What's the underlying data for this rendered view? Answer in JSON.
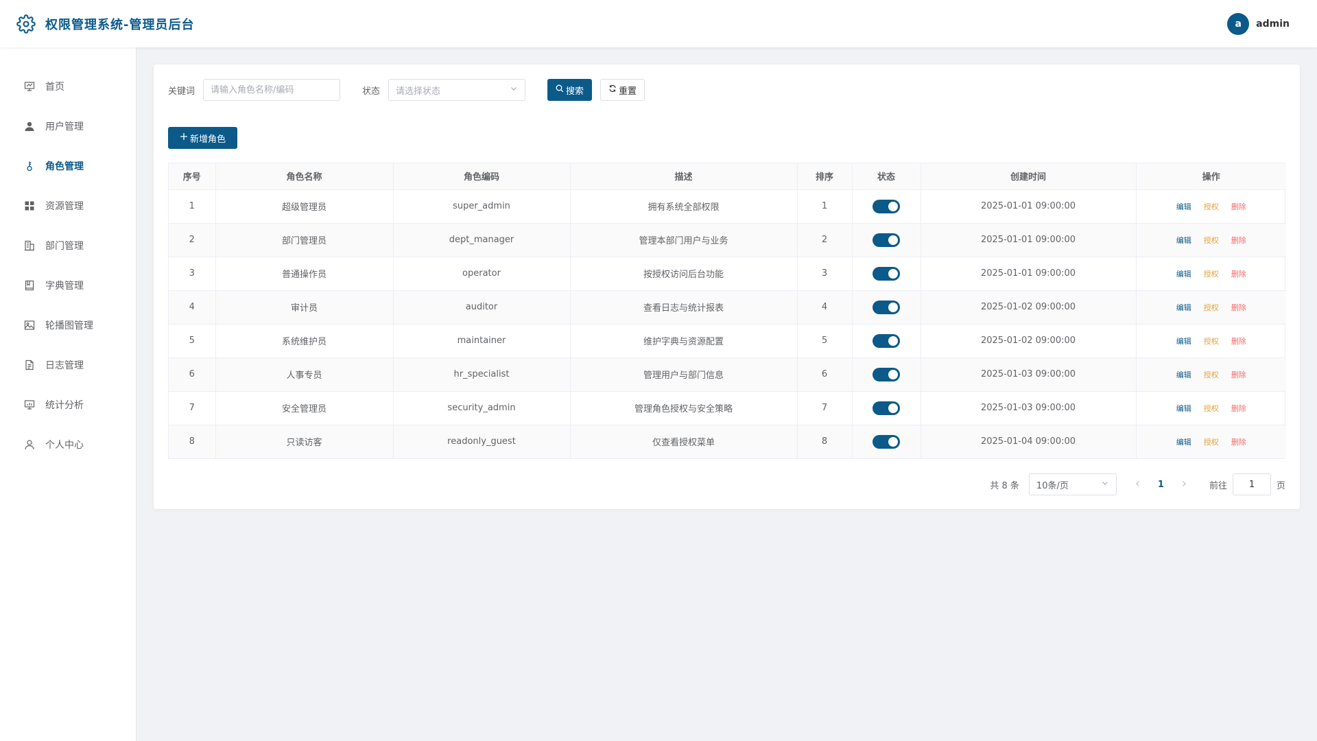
{
  "header": {
    "title": "权限管理系统-管理员后台",
    "avatar_letter": "a",
    "username": "admin"
  },
  "sidebar": {
    "items": [
      {
        "label": "首页",
        "icon": "presentation-board-icon",
        "active": false
      },
      {
        "label": "用户管理",
        "icon": "user-icon",
        "active": false
      },
      {
        "label": "角色管理",
        "icon": "key-icon",
        "active": true
      },
      {
        "label": "资源管理",
        "icon": "grid-icon",
        "active": false
      },
      {
        "label": "部门管理",
        "icon": "building-icon",
        "active": false
      },
      {
        "label": "字典管理",
        "icon": "book-icon",
        "active": false
      },
      {
        "label": "轮播图管理",
        "icon": "image-icon",
        "active": false
      },
      {
        "label": "日志管理",
        "icon": "document-icon",
        "active": false
      },
      {
        "label": "统计分析",
        "icon": "chart-board-icon",
        "active": false
      },
      {
        "label": "个人中心",
        "icon": "user-outline-icon",
        "active": false
      }
    ]
  },
  "filters": {
    "keyword_label": "关键词",
    "keyword_placeholder": "请输入角色名称/编码",
    "keyword_value": "",
    "status_label": "状态",
    "status_placeholder": "请选择状态",
    "search_label": "搜索",
    "reset_label": "重置"
  },
  "actions": {
    "add_label": "新增角色"
  },
  "table": {
    "columns": [
      "序号",
      "角色名称",
      "角色编码",
      "描述",
      "排序",
      "状态",
      "创建时间",
      "操作"
    ],
    "rows": [
      {
        "index": "1",
        "name": "超级管理员",
        "code": "super_admin",
        "desc": "拥有系统全部权限",
        "sort": "1",
        "enabled": true,
        "created": "2025-01-01 09:00:00"
      },
      {
        "index": "2",
        "name": "部门管理员",
        "code": "dept_manager",
        "desc": "管理本部门用户与业务",
        "sort": "2",
        "enabled": true,
        "created": "2025-01-01 09:00:00"
      },
      {
        "index": "3",
        "name": "普通操作员",
        "code": "operator",
        "desc": "按授权访问后台功能",
        "sort": "3",
        "enabled": true,
        "created": "2025-01-01 09:00:00"
      },
      {
        "index": "4",
        "name": "审计员",
        "code": "auditor",
        "desc": "查看日志与统计报表",
        "sort": "4",
        "enabled": true,
        "created": "2025-01-02 09:00:00"
      },
      {
        "index": "5",
        "name": "系统维护员",
        "code": "maintainer",
        "desc": "维护字典与资源配置",
        "sort": "5",
        "enabled": true,
        "created": "2025-01-02 09:00:00"
      },
      {
        "index": "6",
        "name": "人事专员",
        "code": "hr_specialist",
        "desc": "管理用户与部门信息",
        "sort": "6",
        "enabled": true,
        "created": "2025-01-03 09:00:00"
      },
      {
        "index": "7",
        "name": "安全管理员",
        "code": "security_admin",
        "desc": "管理角色授权与安全策略",
        "sort": "7",
        "enabled": true,
        "created": "2025-01-03 09:00:00"
      },
      {
        "index": "8",
        "name": "只读访客",
        "code": "readonly_guest",
        "desc": "仅查看授权菜单",
        "sort": "8",
        "enabled": true,
        "created": "2025-01-04 09:00:00"
      }
    ],
    "op_edit": "编辑",
    "op_auth": "授权",
    "op_delete": "删除"
  },
  "pagination": {
    "total_text": "共 8 条",
    "page_size": "10条/页",
    "current_page": "1",
    "goto_label": "前往",
    "goto_value": "1",
    "page_unit": "页"
  },
  "colors": {
    "primary": "#0b5a8a",
    "auth": "#e6a23c",
    "danger": "#f56c6c",
    "background": "#f0f2f5"
  }
}
